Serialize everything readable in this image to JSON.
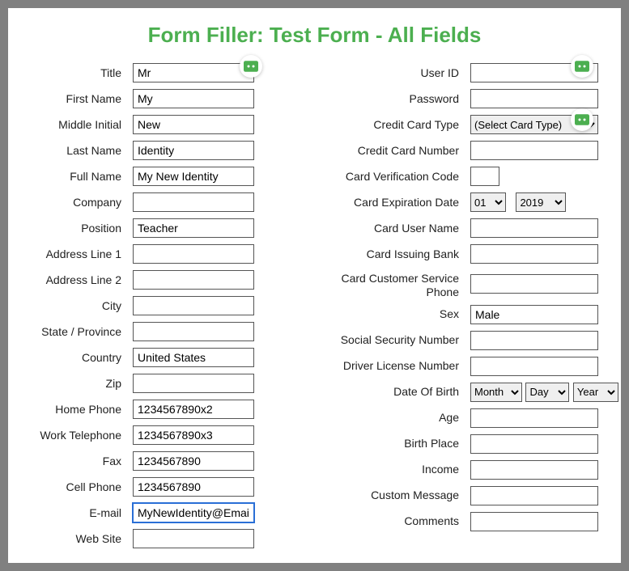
{
  "page_title": "Form Filler: Test Form - All Fields",
  "left": {
    "title": {
      "label": "Title",
      "value": "Mr"
    },
    "first_name": {
      "label": "First Name",
      "value": "My"
    },
    "middle_initial": {
      "label": "Middle Initial",
      "value": "New"
    },
    "last_name": {
      "label": "Last Name",
      "value": "Identity"
    },
    "full_name": {
      "label": "Full Name",
      "value": "My New Identity"
    },
    "company": {
      "label": "Company",
      "value": ""
    },
    "position": {
      "label": "Position",
      "value": "Teacher"
    },
    "address1": {
      "label": "Address Line 1",
      "value": ""
    },
    "address2": {
      "label": "Address Line 2",
      "value": ""
    },
    "city": {
      "label": "City",
      "value": ""
    },
    "state": {
      "label": "State / Province",
      "value": ""
    },
    "country": {
      "label": "Country",
      "value": "United States"
    },
    "zip": {
      "label": "Zip",
      "value": ""
    },
    "home_phone": {
      "label": "Home Phone",
      "value": "1234567890x2"
    },
    "work_phone": {
      "label": "Work Telephone",
      "value": "1234567890x3"
    },
    "fax": {
      "label": "Fax",
      "value": "1234567890"
    },
    "cell_phone": {
      "label": "Cell Phone",
      "value": "1234567890"
    },
    "email": {
      "label": "E-mail",
      "value": "MyNewIdentity@Email."
    },
    "website": {
      "label": "Web Site",
      "value": ""
    }
  },
  "right": {
    "user_id": {
      "label": "User ID",
      "value": ""
    },
    "password": {
      "label": "Password",
      "value": ""
    },
    "card_type": {
      "label": "Credit Card Type",
      "selected": "(Select Card Type)"
    },
    "card_number": {
      "label": "Credit Card Number",
      "value": ""
    },
    "cvv": {
      "label": "Card Verification Code",
      "value": ""
    },
    "card_exp": {
      "label": "Card Expiration Date",
      "month": "01",
      "year": "2019"
    },
    "card_user": {
      "label": "Card User Name",
      "value": ""
    },
    "card_bank": {
      "label": "Card Issuing Bank",
      "value": ""
    },
    "card_service": {
      "label": "Card Customer Service Phone",
      "value": ""
    },
    "sex": {
      "label": "Sex",
      "value": "Male"
    },
    "ssn": {
      "label": "Social Security Number",
      "value": ""
    },
    "dln": {
      "label": "Driver License Number",
      "value": ""
    },
    "dob": {
      "label": "Date Of Birth",
      "month": "Month",
      "day": "Day",
      "year": "Year"
    },
    "age": {
      "label": "Age",
      "value": ""
    },
    "birth_place": {
      "label": "Birth Place",
      "value": ""
    },
    "income": {
      "label": "Income",
      "value": ""
    },
    "custom": {
      "label": "Custom Message",
      "value": ""
    },
    "comments": {
      "label": "Comments",
      "value": ""
    }
  },
  "icons": {
    "ext_badge": "roboform-badge"
  }
}
